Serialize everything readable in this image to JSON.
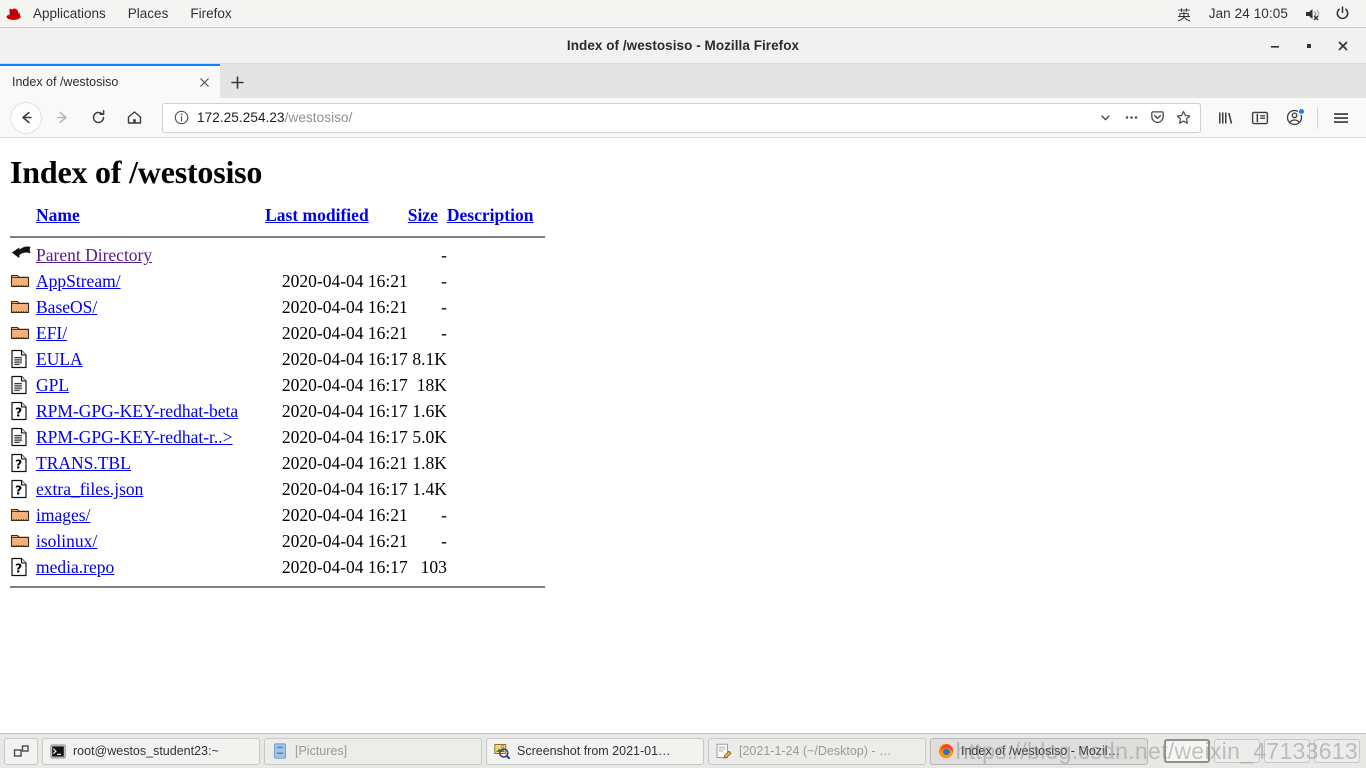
{
  "panel": {
    "logo": "redhat-logo",
    "menus": [
      "Applications",
      "Places",
      "Firefox"
    ],
    "ime": "英",
    "clock": "Jan 24  10:05",
    "volume_icon": "volume-muted-icon",
    "power_icon": "power-icon"
  },
  "window": {
    "title": "Index of /westosiso - Mozilla Firefox",
    "minimize_label": "—",
    "maximize_label": "▫",
    "close_label": "✕"
  },
  "tabs": [
    {
      "title": "Index of /westosiso",
      "close_label": "✕"
    }
  ],
  "newtab_label": "+",
  "navbar": {
    "back_icon": "back-arrow-icon",
    "forward_icon": "forward-arrow-icon",
    "reload_icon": "reload-icon",
    "home_icon": "home-icon",
    "identity_icon": "info-circle-icon",
    "url_host": "172.25.254.23",
    "url_path": "/westosiso/",
    "url_full": "172.25.254.23/westosiso/",
    "dropdown_icon": "chevron-down-icon",
    "pageactions_icon": "ellipsis-icon",
    "pocket_icon": "pocket-icon",
    "bookmark_icon": "star-icon",
    "library_icon": "library-icon",
    "sidebar_icon": "sidebar-icon",
    "account_icon": "account-icon",
    "menu_icon": "hamburger-menu-icon"
  },
  "page": {
    "heading": "Index of /westosiso",
    "columns": [
      {
        "key": "name",
        "label": "Name"
      },
      {
        "key": "modified",
        "label": "Last modified"
      },
      {
        "key": "size",
        "label": "Size"
      },
      {
        "key": "description",
        "label": "Description"
      }
    ],
    "rows": [
      {
        "icon": "parent-directory-icon",
        "name": "Parent Directory",
        "modified": "",
        "size": "-",
        "description": "",
        "visited": true
      },
      {
        "icon": "folder-icon",
        "name": "AppStream/",
        "modified": "2020-04-04 16:21",
        "size": "-",
        "description": ""
      },
      {
        "icon": "folder-icon",
        "name": "BaseOS/",
        "modified": "2020-04-04 16:21",
        "size": "-",
        "description": ""
      },
      {
        "icon": "folder-icon",
        "name": "EFI/",
        "modified": "2020-04-04 16:21",
        "size": "-",
        "description": ""
      },
      {
        "icon": "text-file-icon",
        "name": "EULA",
        "modified": "2020-04-04 16:17",
        "size": "8.1K",
        "description": ""
      },
      {
        "icon": "text-file-icon",
        "name": "GPL",
        "modified": "2020-04-04 16:17",
        "size": "18K",
        "description": ""
      },
      {
        "icon": "unknown-file-icon",
        "name": "RPM-GPG-KEY-redhat-beta",
        "modified": "2020-04-04 16:17",
        "size": "1.6K",
        "description": ""
      },
      {
        "icon": "text-file-icon",
        "name": "RPM-GPG-KEY-redhat-r..>",
        "modified": "2020-04-04 16:17",
        "size": "5.0K",
        "description": ""
      },
      {
        "icon": "unknown-file-icon",
        "name": "TRANS.TBL",
        "modified": "2020-04-04 16:21",
        "size": "1.8K",
        "description": ""
      },
      {
        "icon": "unknown-file-icon",
        "name": "extra_files.json",
        "modified": "2020-04-04 16:17",
        "size": "1.4K",
        "description": ""
      },
      {
        "icon": "folder-icon",
        "name": "images/",
        "modified": "2020-04-04 16:21",
        "size": "-",
        "description": ""
      },
      {
        "icon": "folder-icon",
        "name": "isolinux/",
        "modified": "2020-04-04 16:21",
        "size": "-",
        "description": ""
      },
      {
        "icon": "unknown-file-icon",
        "name": "media.repo",
        "modified": "2020-04-04 16:17",
        "size": "103",
        "description": ""
      }
    ]
  },
  "taskbar": {
    "show_desktop_icon": "show-desktop-icon",
    "tasks": [
      {
        "icon": "terminal-icon",
        "label": "root@westos_student23:~",
        "state": "normal"
      },
      {
        "icon": "files-icon",
        "label": "[Pictures]",
        "state": "minimized"
      },
      {
        "icon": "image-viewer-icon",
        "label": "Screenshot from 2021-01…",
        "state": "normal"
      },
      {
        "icon": "gedit-icon",
        "label": "[2021-1-24 (~/Desktop) - …",
        "state": "minimized"
      },
      {
        "icon": "firefox-icon",
        "label": "Index of /westosiso - Mozil…",
        "state": "active"
      }
    ],
    "workspaces": [
      {
        "current": true
      },
      {
        "current": false
      },
      {
        "current": false
      },
      {
        "current": false
      }
    ]
  },
  "watermark": "https://blog.csdn.net/weixin_47133613",
  "colors": {
    "link": "#0000ee",
    "visited_link": "#551a8b",
    "tab_accent": "#0a84ff",
    "panel_bg": "#f4f4f3",
    "taskbar_bg": "#e8e8e6"
  }
}
